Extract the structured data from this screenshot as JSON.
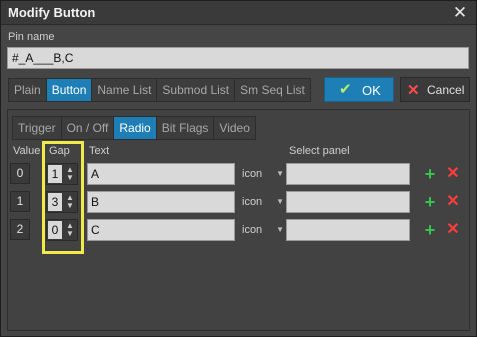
{
  "window": {
    "title": "Modify Button",
    "close_glyph": "✕"
  },
  "pin": {
    "label": "Pin name",
    "value": "#_A___B,C"
  },
  "type_tabs": [
    {
      "label": "Plain",
      "active": false
    },
    {
      "label": "Button",
      "active": true
    },
    {
      "label": "Name List",
      "active": false
    },
    {
      "label": "Submod List",
      "active": false
    },
    {
      "label": "Sm Seq List",
      "active": false
    }
  ],
  "ok_button": {
    "label": "OK",
    "icon": "check-icon"
  },
  "cancel_button": {
    "label": "Cancel",
    "icon": "x-icon"
  },
  "mode_tabs": [
    {
      "label": "Trigger",
      "active": false
    },
    {
      "label": "On / Off",
      "active": false
    },
    {
      "label": "Radio",
      "active": true
    },
    {
      "label": "Bit Flags",
      "active": false
    },
    {
      "label": "Video",
      "active": false
    }
  ],
  "table_headers": {
    "value": "Value",
    "gap": "Gap",
    "text": "Text",
    "select_panel": "Select panel"
  },
  "rows": [
    {
      "value": "0",
      "gap": "1",
      "text": "A",
      "icon": "icon",
      "select_panel": ""
    },
    {
      "value": "1",
      "gap": "3",
      "text": "B",
      "icon": "icon",
      "select_panel": ""
    },
    {
      "value": "2",
      "gap": "0",
      "text": "C",
      "icon": "icon",
      "select_panel": ""
    }
  ],
  "colors": {
    "accent": "#1e7fb6",
    "highlight": "#f2e94a",
    "add": "#38c34a",
    "delete": "#ff3d3d"
  }
}
